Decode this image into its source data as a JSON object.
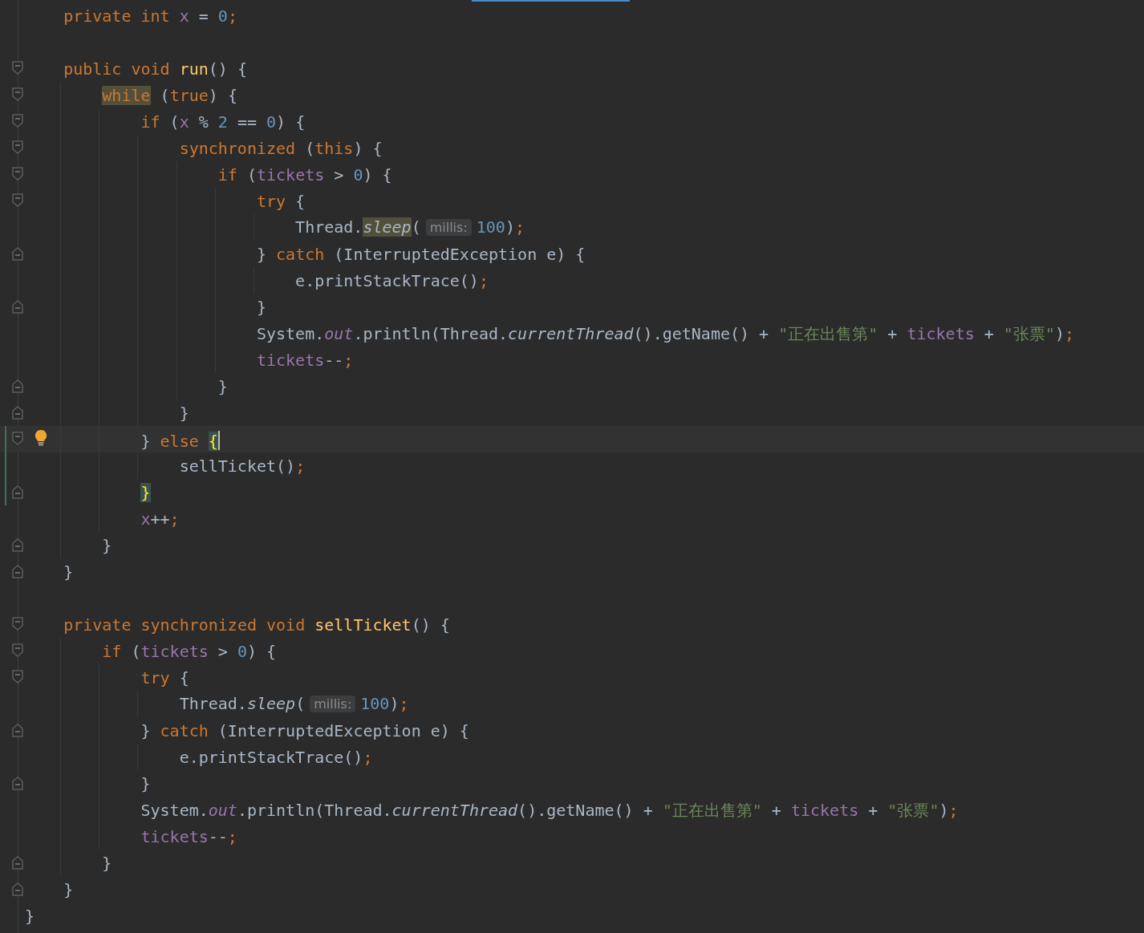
{
  "editor": {
    "lines": [
      {
        "fold_start": false,
        "fold_end": false,
        "changed": false,
        "current": false,
        "bulb": false,
        "tokens": [
          {
            "kind": "keyword",
            "text": "private int "
          },
          {
            "kind": "field",
            "text": "x"
          },
          {
            "kind": "plain",
            "text": " = "
          },
          {
            "kind": "number",
            "text": "0"
          },
          {
            "kind": "punct",
            "text": ";"
          }
        ]
      },
      {
        "fold_start": false,
        "fold_end": false,
        "changed": false,
        "current": false,
        "bulb": false
      },
      {
        "fold_start": true,
        "fold_end": false,
        "changed": false,
        "current": false,
        "bulb": false,
        "tokens": [
          {
            "kind": "keyword",
            "text": "public void "
          },
          {
            "kind": "method-decl",
            "text": "run"
          },
          {
            "kind": "plain",
            "text": "() {"
          }
        ],
        "children": [
          {
            "fold_start": true,
            "fold_end": false,
            "changed": false,
            "current": false,
            "bulb": false,
            "tokens": [
              {
                "kind": "keyword-marked",
                "text": "while"
              },
              {
                "kind": "plain",
                "text": " ("
              },
              {
                "kind": "keyword",
                "text": "true"
              },
              {
                "kind": "plain",
                "text": ") {"
              }
            ],
            "children": [
              {
                "fold_start": true,
                "fold_end": false,
                "changed": false,
                "current": false,
                "bulb": false,
                "tokens": [
                  {
                    "kind": "keyword",
                    "text": "if"
                  },
                  {
                    "kind": "plain",
                    "text": " ("
                  },
                  {
                    "kind": "field",
                    "text": "x"
                  },
                  {
                    "kind": "plain",
                    "text": " % "
                  },
                  {
                    "kind": "number",
                    "text": "2"
                  },
                  {
                    "kind": "plain",
                    "text": " == "
                  },
                  {
                    "kind": "number",
                    "text": "0"
                  },
                  {
                    "kind": "plain",
                    "text": ") {"
                  }
                ],
                "children": [
                  {
                    "fold_start": true,
                    "fold_end": false,
                    "changed": false,
                    "current": false,
                    "bulb": false,
                    "tokens": [
                      {
                        "kind": "keyword",
                        "text": "synchronized"
                      },
                      {
                        "kind": "plain",
                        "text": " ("
                      },
                      {
                        "kind": "keyword",
                        "text": "this"
                      },
                      {
                        "kind": "plain",
                        "text": ") {"
                      }
                    ],
                    "children": [
                      {
                        "fold_start": true,
                        "fold_end": false,
                        "changed": false,
                        "current": false,
                        "bulb": false,
                        "tokens": [
                          {
                            "kind": "keyword",
                            "text": "if"
                          },
                          {
                            "kind": "plain",
                            "text": " ("
                          },
                          {
                            "kind": "field",
                            "text": "tickets"
                          },
                          {
                            "kind": "plain",
                            "text": " > "
                          },
                          {
                            "kind": "number",
                            "text": "0"
                          },
                          {
                            "kind": "plain",
                            "text": ") {"
                          }
                        ],
                        "children": [
                          {
                            "fold_start": true,
                            "fold_end": false,
                            "changed": false,
                            "current": false,
                            "bulb": false,
                            "tokens": [
                              {
                                "kind": "keyword",
                                "text": "try"
                              },
                              {
                                "kind": "plain",
                                "text": " {"
                              }
                            ],
                            "children": [
                              {
                                "fold_start": false,
                                "fold_end": false,
                                "changed": false,
                                "current": false,
                                "bulb": false,
                                "tokens": [
                                  {
                                    "kind": "plain",
                                    "text": "Thread."
                                  },
                                  {
                                    "kind": "method-static-marked",
                                    "text": "sleep"
                                  },
                                  {
                                    "kind": "plain",
                                    "text": "("
                                  },
                                  {
                                    "kind": "hint",
                                    "text": "millis:"
                                  },
                                  {
                                    "kind": "number",
                                    "text": "100"
                                  },
                                  {
                                    "kind": "plain",
                                    "text": ")"
                                  },
                                  {
                                    "kind": "punct",
                                    "text": ";"
                                  }
                                ]
                              }
                            ]
                          },
                          {
                            "fold_start": false,
                            "fold_end": true,
                            "changed": false,
                            "current": false,
                            "bulb": false,
                            "tokens": [
                              {
                                "kind": "plain",
                                "text": "} "
                              },
                              {
                                "kind": "keyword",
                                "text": "catch"
                              },
                              {
                                "kind": "plain",
                                "text": " (InterruptedException e) {"
                              }
                            ],
                            "children": [
                              {
                                "fold_start": false,
                                "fold_end": false,
                                "changed": false,
                                "current": false,
                                "bulb": false,
                                "tokens": [
                                  {
                                    "kind": "plain",
                                    "text": "e.printStackTrace()"
                                  },
                                  {
                                    "kind": "punct",
                                    "text": ";"
                                  }
                                ]
                              }
                            ]
                          },
                          {
                            "fold_start": false,
                            "fold_end": true,
                            "changed": false,
                            "current": false,
                            "bulb": false,
                            "tokens": [
                              {
                                "kind": "plain",
                                "text": "}"
                              }
                            ]
                          },
                          {
                            "fold_start": false,
                            "fold_end": false,
                            "changed": false,
                            "current": false,
                            "bulb": false,
                            "tokens": [
                              {
                                "kind": "plain",
                                "text": "System."
                              },
                              {
                                "kind": "field-static",
                                "text": "out"
                              },
                              {
                                "kind": "plain",
                                "text": ".println(Thread."
                              },
                              {
                                "kind": "method-static",
                                "text": "currentThread"
                              },
                              {
                                "kind": "plain",
                                "text": "().getName() + "
                              },
                              {
                                "kind": "string",
                                "text": "\"正在出售第\""
                              },
                              {
                                "kind": "plain",
                                "text": " + "
                              },
                              {
                                "kind": "field",
                                "text": "tickets"
                              },
                              {
                                "kind": "plain",
                                "text": " + "
                              },
                              {
                                "kind": "string",
                                "text": "\"张票\""
                              },
                              {
                                "kind": "plain",
                                "text": ")"
                              },
                              {
                                "kind": "punct",
                                "text": ";"
                              }
                            ]
                          },
                          {
                            "fold_start": false,
                            "fold_end": false,
                            "changed": false,
                            "current": false,
                            "bulb": false,
                            "tokens": [
                              {
                                "kind": "field",
                                "text": "tickets"
                              },
                              {
                                "kind": "plain",
                                "text": "--"
                              },
                              {
                                "kind": "punct",
                                "text": ";"
                              }
                            ]
                          }
                        ]
                      },
                      {
                        "fold_start": false,
                        "fold_end": true,
                        "changed": false,
                        "current": false,
                        "bulb": false,
                        "tokens": [
                          {
                            "kind": "plain",
                            "text": "}"
                          }
                        ]
                      }
                    ]
                  },
                  {
                    "fold_start": false,
                    "fold_end": true,
                    "changed": false,
                    "current": false,
                    "bulb": false,
                    "tokens": [
                      {
                        "kind": "plain",
                        "text": "}"
                      }
                    ]
                  }
                ]
              },
              {
                "fold_start": true,
                "fold_end": false,
                "changed": true,
                "current": true,
                "bulb": true,
                "tokens": [
                  {
                    "kind": "plain",
                    "text": "} "
                  },
                  {
                    "kind": "keyword",
                    "text": "else "
                  },
                  {
                    "kind": "brace-matched",
                    "text": "{"
                  }
                ],
                "children": [
                  {
                    "fold_start": false,
                    "fold_end": false,
                    "changed": true,
                    "current": false,
                    "bulb": false,
                    "tokens": [
                      {
                        "kind": "plain",
                        "text": "sellTicket()"
                      },
                      {
                        "kind": "punct",
                        "text": ";"
                      }
                    ]
                  }
                ]
              },
              {
                "fold_start": false,
                "fold_end": true,
                "changed": true,
                "current": false,
                "bulb": false,
                "tokens": [
                  {
                    "kind": "brace-matched",
                    "text": "}"
                  }
                ]
              },
              {
                "fold_start": false,
                "fold_end": false,
                "changed": false,
                "current": false,
                "bulb": false,
                "tokens": [
                  {
                    "kind": "field",
                    "text": "x"
                  },
                  {
                    "kind": "plain",
                    "text": "++"
                  },
                  {
                    "kind": "punct",
                    "text": ";"
                  }
                ]
              }
            ]
          },
          {
            "fold_start": false,
            "fold_end": true,
            "changed": false,
            "current": false,
            "bulb": false,
            "tokens": [
              {
                "kind": "plain",
                "text": "}"
              }
            ]
          }
        ]
      },
      {
        "fold_start": false,
        "fold_end": true,
        "changed": false,
        "current": false,
        "bulb": false,
        "tokens": [
          {
            "kind": "plain",
            "text": "}"
          }
        ]
      },
      {
        "fold_start": false,
        "fold_end": false,
        "changed": false,
        "current": false,
        "bulb": false
      },
      {
        "fold_start": true,
        "fold_end": false,
        "changed": false,
        "current": false,
        "bulb": false,
        "tokens": [
          {
            "kind": "keyword",
            "text": "private synchronized void "
          },
          {
            "kind": "method-decl",
            "text": "sellTicket"
          },
          {
            "kind": "plain",
            "text": "() {"
          }
        ],
        "children": [
          {
            "fold_start": true,
            "fold_end": false,
            "changed": false,
            "current": false,
            "bulb": false,
            "tokens": [
              {
                "kind": "keyword",
                "text": "if"
              },
              {
                "kind": "plain",
                "text": " ("
              },
              {
                "kind": "field",
                "text": "tickets"
              },
              {
                "kind": "plain",
                "text": " > "
              },
              {
                "kind": "number",
                "text": "0"
              },
              {
                "kind": "plain",
                "text": ") {"
              }
            ],
            "children": [
              {
                "fold_start": true,
                "fold_end": false,
                "changed": false,
                "current": false,
                "bulb": false,
                "tokens": [
                  {
                    "kind": "keyword",
                    "text": "try"
                  },
                  {
                    "kind": "plain",
                    "text": " {"
                  }
                ],
                "children": [
                  {
                    "fold_start": false,
                    "fold_end": false,
                    "changed": false,
                    "current": false,
                    "bulb": false,
                    "tokens": [
                      {
                        "kind": "plain",
                        "text": "Thread."
                      },
                      {
                        "kind": "method-static",
                        "text": "sleep"
                      },
                      {
                        "kind": "plain",
                        "text": "("
                      },
                      {
                        "kind": "hint",
                        "text": "millis:"
                      },
                      {
                        "kind": "number",
                        "text": "100"
                      },
                      {
                        "kind": "plain",
                        "text": ")"
                      },
                      {
                        "kind": "punct",
                        "text": ";"
                      }
                    ]
                  }
                ]
              },
              {
                "fold_start": false,
                "fold_end": true,
                "changed": false,
                "current": false,
                "bulb": false,
                "tokens": [
                  {
                    "kind": "plain",
                    "text": "} "
                  },
                  {
                    "kind": "keyword",
                    "text": "catch"
                  },
                  {
                    "kind": "plain",
                    "text": " (InterruptedException e) {"
                  }
                ],
                "children": [
                  {
                    "fold_start": false,
                    "fold_end": false,
                    "changed": false,
                    "current": false,
                    "bulb": false,
                    "tokens": [
                      {
                        "kind": "plain",
                        "text": "e.printStackTrace()"
                      },
                      {
                        "kind": "punct",
                        "text": ";"
                      }
                    ]
                  }
                ]
              },
              {
                "fold_start": false,
                "fold_end": true,
                "changed": false,
                "current": false,
                "bulb": false,
                "tokens": [
                  {
                    "kind": "plain",
                    "text": "}"
                  }
                ]
              },
              {
                "fold_start": false,
                "fold_end": false,
                "changed": false,
                "current": false,
                "bulb": false,
                "tokens": [
                  {
                    "kind": "plain",
                    "text": "System."
                  },
                  {
                    "kind": "field-static",
                    "text": "out"
                  },
                  {
                    "kind": "plain",
                    "text": ".println(Thread."
                  },
                  {
                    "kind": "method-static",
                    "text": "currentThread"
                  },
                  {
                    "kind": "plain",
                    "text": "().getName() + "
                  },
                  {
                    "kind": "string",
                    "text": "\"正在出售第\""
                  },
                  {
                    "kind": "plain",
                    "text": " + "
                  },
                  {
                    "kind": "field",
                    "text": "tickets"
                  },
                  {
                    "kind": "plain",
                    "text": " + "
                  },
                  {
                    "kind": "string",
                    "text": "\"张票\""
                  },
                  {
                    "kind": "plain",
                    "text": ")"
                  },
                  {
                    "kind": "punct",
                    "text": ";"
                  }
                ]
              },
              {
                "fold_start": false,
                "fold_end": false,
                "changed": false,
                "current": false,
                "bulb": false,
                "tokens": [
                  {
                    "kind": "field",
                    "text": "tickets"
                  },
                  {
                    "kind": "plain",
                    "text": "--"
                  },
                  {
                    "kind": "punct",
                    "text": ";"
                  }
                ]
              }
            ]
          },
          {
            "fold_start": false,
            "fold_end": true,
            "changed": false,
            "current": false,
            "bulb": false,
            "tokens": [
              {
                "kind": "plain",
                "text": "}"
              }
            ]
          }
        ]
      },
      {
        "fold_start": false,
        "fold_end": true,
        "changed": false,
        "current": false,
        "bulb": false,
        "tokens": [
          {
            "kind": "plain",
            "text": "}"
          }
        ]
      }
    ],
    "closing_line": {
      "fold_start": false,
      "fold_end": false,
      "changed": false,
      "current": false,
      "bulb": false,
      "tokens": [
        {
          "kind": "plain",
          "text": "}"
        }
      ]
    }
  }
}
